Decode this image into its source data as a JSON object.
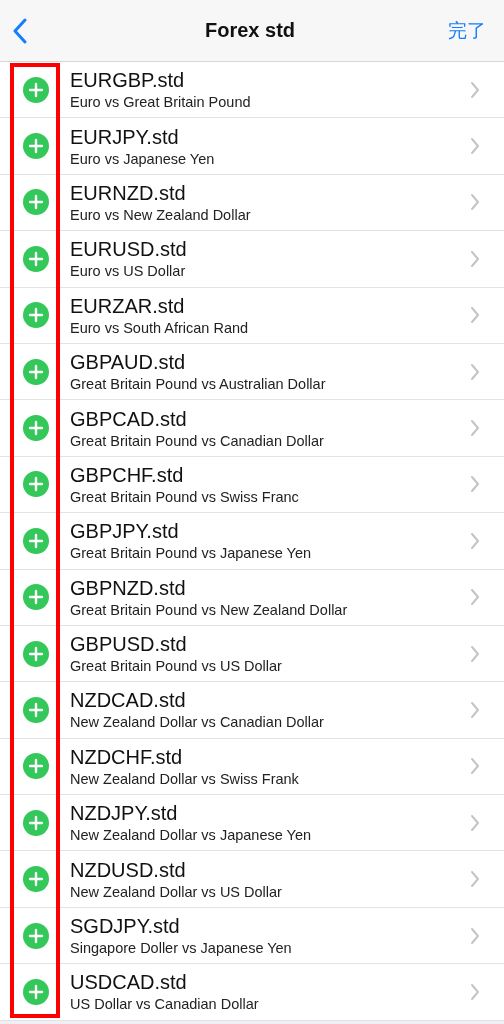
{
  "nav": {
    "title": "Forex std",
    "done": "完了"
  },
  "symbols": [
    {
      "name": "EURGBP.std",
      "description": "Euro vs Great Britain Pound"
    },
    {
      "name": "EURJPY.std",
      "description": "Euro vs Japanese Yen"
    },
    {
      "name": "EURNZD.std",
      "description": "Euro vs New Zealand Dollar"
    },
    {
      "name": "EURUSD.std",
      "description": "Euro vs US Dollar"
    },
    {
      "name": "EURZAR.std",
      "description": "Euro vs South African Rand"
    },
    {
      "name": "GBPAUD.std",
      "description": "Great Britain Pound vs Australian Dollar"
    },
    {
      "name": "GBPCAD.std",
      "description": "Great Britain Pound vs Canadian Dollar"
    },
    {
      "name": "GBPCHF.std",
      "description": "Great Britain Pound vs Swiss Franc"
    },
    {
      "name": "GBPJPY.std",
      "description": "Great Britain Pound vs Japanese Yen"
    },
    {
      "name": "GBPNZD.std",
      "description": "Great Britain Pound vs New Zealand Dollar"
    },
    {
      "name": "GBPUSD.std",
      "description": "Great Britain Pound vs US Dollar"
    },
    {
      "name": "NZDCAD.std",
      "description": "New Zealand Dollar vs Canadian Dollar"
    },
    {
      "name": "NZDCHF.std",
      "description": "New Zealand Dollar vs Swiss Frank"
    },
    {
      "name": "NZDJPY.std",
      "description": "New Zealand Dollar vs Japanese Yen"
    },
    {
      "name": "NZDUSD.std",
      "description": "New Zealand Dollar vs US Dollar"
    },
    {
      "name": "SGDJPY.std",
      "description": "Singapore Doller vs Japanese Yen"
    },
    {
      "name": "USDCAD.std",
      "description": "US Dollar vs Canadian Dollar"
    }
  ]
}
